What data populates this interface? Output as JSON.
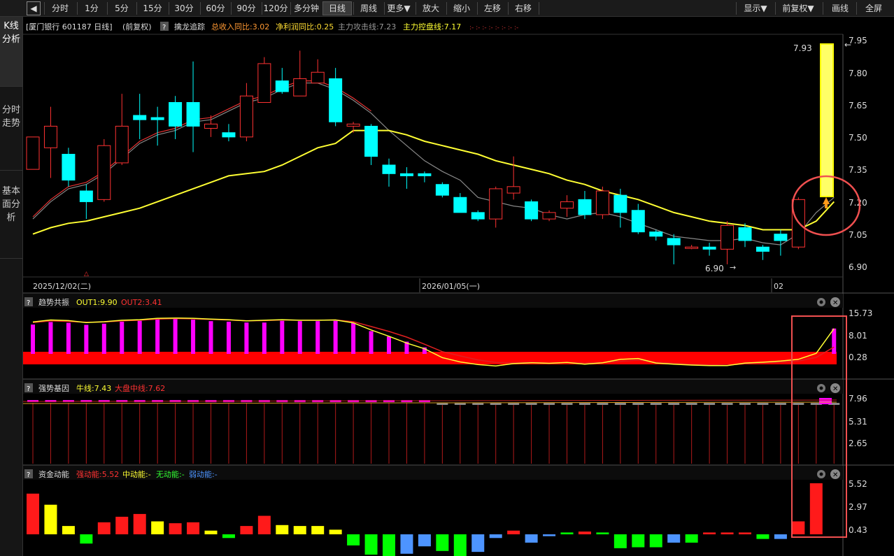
{
  "toolbar": {
    "back_icon": "back-arrow-icon",
    "items": [
      "分时",
      "1分",
      "5分",
      "15分",
      "30分",
      "60分",
      "90分",
      "120分",
      "多分钟",
      "日线",
      "周线",
      "更多▼",
      "放大",
      "缩小",
      "左移",
      "右移"
    ],
    "active": "日线",
    "right": [
      "显示▼",
      "前复权▼",
      "画线",
      "全屏"
    ]
  },
  "sidebar": {
    "tabs": [
      "K线分析",
      "分时走势",
      "基本面分析"
    ]
  },
  "stock": {
    "header": "[厦门银行 601187 日线]",
    "adjust": "(前复权)",
    "help": "?",
    "indicator": "擒龙追踪",
    "total_income": "总收入同比:3.02",
    "net_profit": "净利润同比:0.25",
    "attack_line": "主力攻击线:7.23",
    "control_line": "主力控盘线:7.17",
    "dots": ":- :- :- :- :- :- :- :-"
  },
  "main_axis": {
    "ticks": [
      "7.95",
      "7.80",
      "7.65",
      "7.50",
      "7.35",
      "7.20",
      "7.05",
      "6.90"
    ],
    "high_label": "7.93",
    "low_label": "6.90",
    "dates": [
      "2025/12/02(二)",
      "2026/01/05(一)",
      "02"
    ]
  },
  "panel1": {
    "name": "趋势共振",
    "out1": "OUT1:9.90",
    "out2": "OUT2:3.41",
    "ticks": [
      "15.73",
      "8.01",
      "0.28"
    ]
  },
  "panel2": {
    "name": "强势基因",
    "bull": "牛线:7.43",
    "market": "大盘中线:7.62",
    "ticks": [
      "7.96",
      "5.31",
      "2.65"
    ]
  },
  "panel3": {
    "name": "资金动能",
    "strong": "强动能:5.52",
    "medium": "中动能:-",
    "none": "无动能:-",
    "weak": "弱动能:-",
    "ticks": [
      "5.52",
      "2.97",
      "0.43"
    ]
  },
  "colors": {
    "up": "#ff3232",
    "down": "#00ffff",
    "ma_red": "#e63232",
    "ma_yellow": "#ffff33",
    "ma_gray": "#888888",
    "magenta": "#ff00ff",
    "band": "#ff0000",
    "vol_red": "#ff1a1a",
    "vol_yellow": "#ffff00",
    "vol_green": "#00ff00",
    "vol_blue": "#4d94ff",
    "highlight": "#f05050"
  },
  "chart_data": [
    {
      "type": "candlestick",
      "title": "厦门银行 601187 日线",
      "ylim": [
        6.9,
        7.95
      ],
      "candles": [
        [
          7.35,
          7.5,
          7.35,
          7.5
        ],
        [
          7.45,
          7.55,
          7.31,
          7.64
        ],
        [
          7.42,
          7.3,
          7.27,
          7.45
        ],
        [
          7.25,
          7.2,
          7.12,
          7.28
        ],
        [
          7.21,
          7.46,
          7.2,
          7.49
        ],
        [
          7.38,
          7.55,
          7.37,
          7.7
        ],
        [
          7.6,
          7.58,
          7.49,
          7.7
        ],
        [
          7.59,
          7.58,
          7.46,
          7.64
        ],
        [
          7.66,
          7.55,
          7.49,
          7.69
        ],
        [
          7.66,
          7.55,
          7.43,
          7.85
        ],
        [
          7.54,
          7.56,
          7.5,
          7.6
        ],
        [
          7.52,
          7.5,
          7.48,
          7.56
        ],
        [
          7.5,
          7.69,
          7.48,
          7.75
        ],
        [
          7.66,
          7.84,
          7.66,
          7.87
        ],
        [
          7.76,
          7.71,
          7.7,
          7.82
        ],
        [
          7.69,
          7.77,
          7.69,
          7.9
        ],
        [
          7.75,
          7.8,
          7.76,
          7.86
        ],
        [
          7.77,
          7.57,
          7.55,
          7.82
        ],
        [
          7.55,
          7.56,
          7.52,
          7.57
        ],
        [
          7.55,
          7.41,
          7.37,
          7.56
        ],
        [
          7.37,
          7.33,
          7.27,
          7.4
        ],
        [
          7.33,
          7.32,
          7.26,
          7.36
        ],
        [
          7.33,
          7.32,
          7.29,
          7.34
        ],
        [
          7.28,
          7.23,
          7.22,
          7.29
        ],
        [
          7.22,
          7.15,
          7.16,
          7.24
        ],
        [
          7.15,
          7.12,
          7.11,
          7.16
        ],
        [
          7.12,
          7.26,
          7.08,
          7.27
        ],
        [
          7.24,
          7.27,
          7.21,
          7.41
        ],
        [
          7.2,
          7.12,
          7.11,
          7.21
        ],
        [
          7.12,
          7.15,
          7.11,
          7.16
        ],
        [
          7.17,
          7.2,
          7.13,
          7.23
        ],
        [
          7.21,
          7.14,
          7.12,
          7.25
        ],
        [
          7.14,
          7.25,
          7.12,
          7.27
        ],
        [
          7.23,
          7.15,
          7.08,
          7.26
        ],
        [
          7.16,
          7.06,
          7.05,
          7.19
        ],
        [
          7.06,
          7.04,
          7.02,
          7.07
        ],
        [
          7.03,
          7.0,
          6.91,
          7.05
        ],
        [
          6.99,
          6.99,
          6.98,
          7.0
        ],
        [
          6.99,
          6.98,
          6.95,
          7.01
        ],
        [
          6.98,
          7.09,
          6.91,
          7.11
        ],
        [
          7.08,
          7.02,
          6.99,
          7.1
        ],
        [
          6.99,
          6.97,
          6.93,
          7.0
        ],
        [
          7.05,
          7.02,
          6.95,
          7.07
        ],
        [
          6.99,
          7.21,
          6.98,
          7.22
        ]
      ],
      "ma_gray": [
        7.12,
        7.2,
        7.26,
        7.28,
        7.33,
        7.4,
        7.47,
        7.51,
        7.53,
        7.57,
        7.58,
        7.62,
        7.66,
        7.68,
        7.72,
        7.75,
        7.75,
        7.72,
        7.67,
        7.61,
        7.53,
        7.46,
        7.39,
        7.34,
        7.3,
        7.22,
        7.2,
        7.18,
        7.17,
        7.14,
        7.12,
        7.14,
        7.15,
        7.13,
        7.1,
        7.07,
        7.04,
        7.03,
        7.02,
        7.02,
        7.03,
        7.01,
        7.0,
        7.05,
        7.15,
        7.22
      ],
      "ma_yellow": [
        7.05,
        7.08,
        7.1,
        7.11,
        7.13,
        7.15,
        7.17,
        7.2,
        7.23,
        7.26,
        7.29,
        7.32,
        7.33,
        7.34,
        7.37,
        7.41,
        7.45,
        7.47,
        7.53,
        7.53,
        7.53,
        7.51,
        7.48,
        7.46,
        7.44,
        7.42,
        7.39,
        7.37,
        7.35,
        7.33,
        7.3,
        7.28,
        7.25,
        7.23,
        7.21,
        7.18,
        7.15,
        7.13,
        7.11,
        7.1,
        7.09,
        7.07,
        7.07,
        7.07,
        7.11,
        7.2
      ]
    },
    {
      "type": "bar",
      "title": "趋势共振",
      "ylim": [
        0.28,
        15.73
      ],
      "values": [
        11.3,
        12.2,
        11.9,
        11.2,
        11.6,
        12.3,
        12.6,
        13.2,
        13.5,
        13.0,
        12.5,
        12.3,
        12.0,
        12.0,
        12.6,
        12.5,
        12.5,
        12.6,
        11.8,
        9.0,
        7.1,
        5.3,
        3.3,
        0,
        0,
        0,
        0,
        0,
        0,
        0,
        0,
        0,
        0,
        0,
        0,
        0,
        0,
        0,
        0,
        0,
        0,
        0,
        0,
        0,
        0,
        9.9
      ],
      "out1": [
        12.2,
        12.9,
        12.7,
        12.0,
        12.3,
        12.8,
        13.0,
        13.5,
        13.6,
        13.5,
        13.2,
        13.0,
        12.6,
        12.8,
        13.0,
        12.8,
        12.8,
        12.9,
        11.9,
        9.4,
        7.2,
        4.8,
        2.8,
        -0.3,
        -1.8,
        -2.7,
        -3.2,
        -2.4,
        -2.1,
        -2.3,
        -2.0,
        -2.6,
        -2.1,
        -0.9,
        -0.6,
        -2.2,
        -2.6,
        -2.9,
        -3.1,
        -3.1,
        -2.2,
        -1.9,
        -1.5,
        -0.9,
        1.2,
        9.9
      ],
      "out2": [
        12.0,
        12.6,
        12.4,
        12.1,
        12.2,
        12.6,
        12.8,
        13.2,
        13.4,
        13.3,
        13.1,
        12.9,
        12.6,
        12.7,
        12.9,
        12.8,
        12.8,
        12.9,
        12.3,
        10.6,
        8.9,
        6.9,
        4.4,
        1.8,
        0.3,
        -1.1,
        -2.0,
        -2.1,
        -1.9,
        -2.2,
        -2.0,
        -2.2,
        -2.0,
        -1.6,
        -1.2,
        -1.9,
        -2.3,
        -2.6,
        -2.8,
        -2.9,
        -2.5,
        -2.2,
        -1.9,
        -1.5,
        -0.2,
        3.41
      ]
    },
    {
      "type": "bar",
      "title": "强势基因",
      "ylim": [
        0,
        7.96
      ],
      "values": [
        7.96,
        7.96,
        7.96,
        7.96,
        7.96,
        7.96,
        7.96,
        7.96,
        7.96,
        7.96,
        7.96,
        7.96,
        7.96,
        7.96,
        7.96,
        7.96,
        7.96,
        7.96,
        7.96,
        7.96,
        7.96,
        7.96,
        7.96,
        7.96,
        7.96,
        7.96,
        7.96,
        7.96,
        7.96,
        7.96,
        7.96,
        7.96,
        7.96,
        7.96,
        7.96,
        7.96,
        7.96,
        7.96,
        7.96,
        7.96,
        7.96,
        7.96,
        7.96,
        7.96,
        7.96,
        7.96
      ],
      "bull": 7.43,
      "market": 7.62
    },
    {
      "type": "bar",
      "title": "资金动能",
      "ylim": [
        -3,
        5.52
      ],
      "values": [
        4.4,
        3.2,
        0.9,
        -1.0,
        1.3,
        1.9,
        2.2,
        1.4,
        1.2,
        1.3,
        0.4,
        -0.4,
        0.9,
        2.0,
        1.0,
        0.9,
        0.9,
        0.5,
        -1.2,
        -2.2,
        -2.6,
        -2.1,
        -1.3,
        -1.8,
        -2.4,
        -1.9,
        -0.4,
        0.4,
        -0.9,
        -0.2,
        0.2,
        0.3,
        0.2,
        -1.5,
        -1.4,
        -1.4,
        -0.9,
        -0.9,
        0.2,
        0.2,
        0.2,
        -0.5,
        -0.5,
        1.4,
        5.52
      ],
      "colors": [
        "red",
        "yellow",
        "yellow",
        "green",
        "red",
        "red",
        "red",
        "yellow",
        "red",
        "red",
        "yellow",
        "green",
        "red",
        "red",
        "yellow",
        "yellow",
        "yellow",
        "yellow",
        "green",
        "green",
        "green",
        "blue",
        "blue",
        "green",
        "green",
        "blue",
        "blue",
        "red",
        "blue",
        "blue",
        "green",
        "red",
        "green",
        "green",
        "green",
        "green",
        "blue",
        "green",
        "red",
        "red",
        "red",
        "green",
        "blue",
        "red",
        "red"
      ]
    }
  ]
}
